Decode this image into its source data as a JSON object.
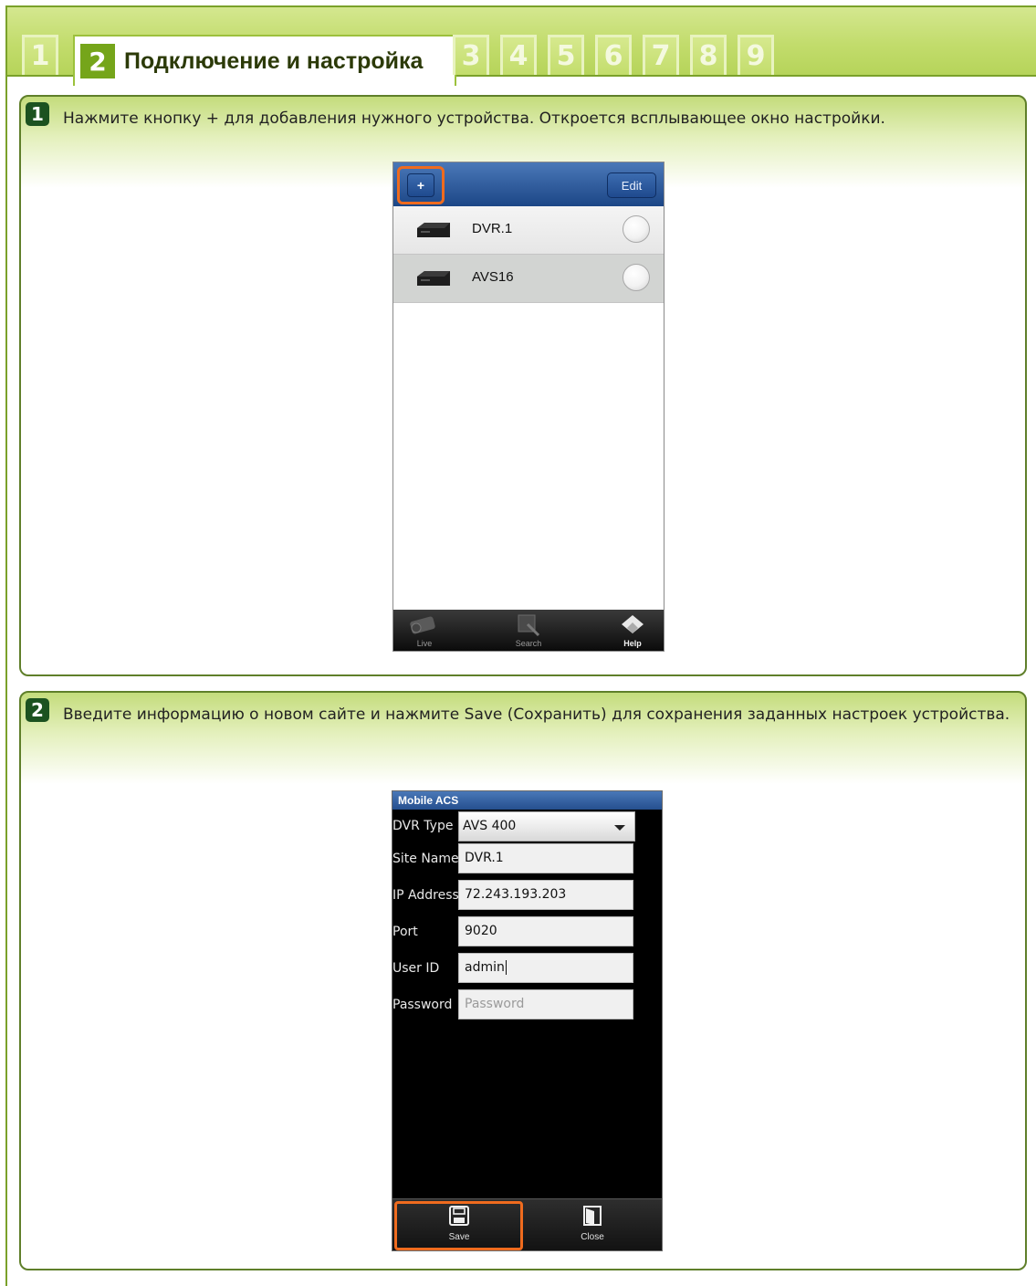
{
  "tabs": {
    "items": [
      "1",
      "2",
      "3",
      "4",
      "5",
      "6",
      "7",
      "8",
      "9"
    ],
    "active_number": "2",
    "active_title": "Подключение и настройка"
  },
  "steps": [
    {
      "number": "1",
      "text": "Нажмите кнопку + для добавления нужного устройства. Откроется всплывающее окно настройки."
    },
    {
      "number": "2",
      "text": "Введите информацию о новом сайте и нажмите Save (Сохранить) для сохранения заданных настроек устройства."
    }
  ],
  "phone1": {
    "add_button": "+",
    "edit_button": "Edit",
    "devices": [
      "DVR.1",
      "AVS16"
    ],
    "footer": {
      "live": "Live",
      "search": "Search",
      "help": "Help"
    }
  },
  "phone2": {
    "title": "Mobile ACS",
    "dvr_type": {
      "label": "DVR Type",
      "value": "AVS 400"
    },
    "site_name": {
      "label": "Site Name",
      "value": "DVR.1"
    },
    "ip_address": {
      "label": "IP Address",
      "value": "72.243.193.203"
    },
    "port": {
      "label": "Port",
      "value": "9020"
    },
    "user_id": {
      "label": "User ID",
      "value": "admin"
    },
    "password": {
      "label": "Password",
      "placeholder": "Password"
    },
    "save": "Save",
    "close": "Close"
  },
  "colors": {
    "tab_green": "#c2dc6c",
    "badge_green": "#1c5220",
    "highlight_orange": "#ef6b1e",
    "header_blue": "#1c4686"
  }
}
